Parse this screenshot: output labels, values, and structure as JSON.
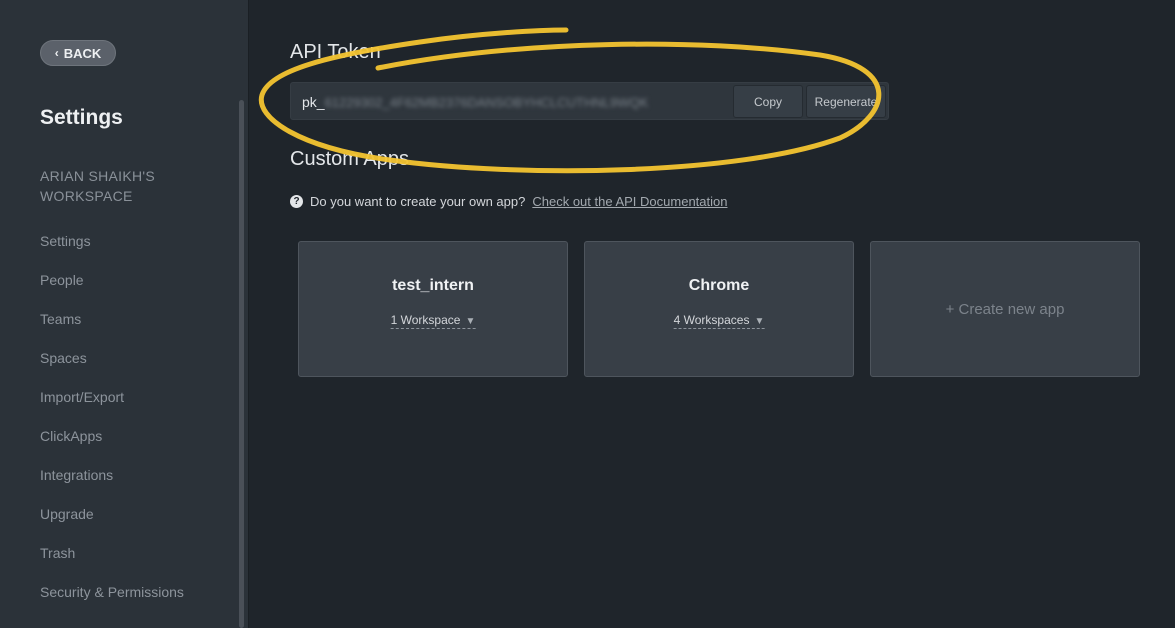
{
  "sidebar": {
    "back_label": "BACK",
    "title": "Settings",
    "workspace": "ARIAN SHAIKH'S WORKSPACE",
    "items": [
      {
        "label": "Settings"
      },
      {
        "label": "People"
      },
      {
        "label": "Teams"
      },
      {
        "label": "Spaces"
      },
      {
        "label": "Import/Export"
      },
      {
        "label": "ClickApps"
      },
      {
        "label": "Integrations"
      },
      {
        "label": "Upgrade"
      },
      {
        "label": "Trash"
      },
      {
        "label": "Security & Permissions"
      }
    ]
  },
  "api": {
    "title": "API Token",
    "token_prefix": "pk_",
    "token_masked": "61229302_4F62MB2376DANSOBYHCLCUTHNL9WQK",
    "copy_label": "Copy",
    "regenerate_label": "Regenerate"
  },
  "custom_apps": {
    "title": "Custom Apps",
    "help_text": "Do you want to create your own app?",
    "doc_link": "Check out the API Documentation",
    "apps": [
      {
        "name": "test_intern",
        "workspaces": "1 Workspace"
      },
      {
        "name": "Chrome",
        "workspaces": "4 Workspaces"
      }
    ],
    "create_label": "+ Create new app"
  },
  "colors": {
    "highlight": "#f4c430",
    "background": "#1f252b",
    "sidebar": "#2b3239"
  }
}
